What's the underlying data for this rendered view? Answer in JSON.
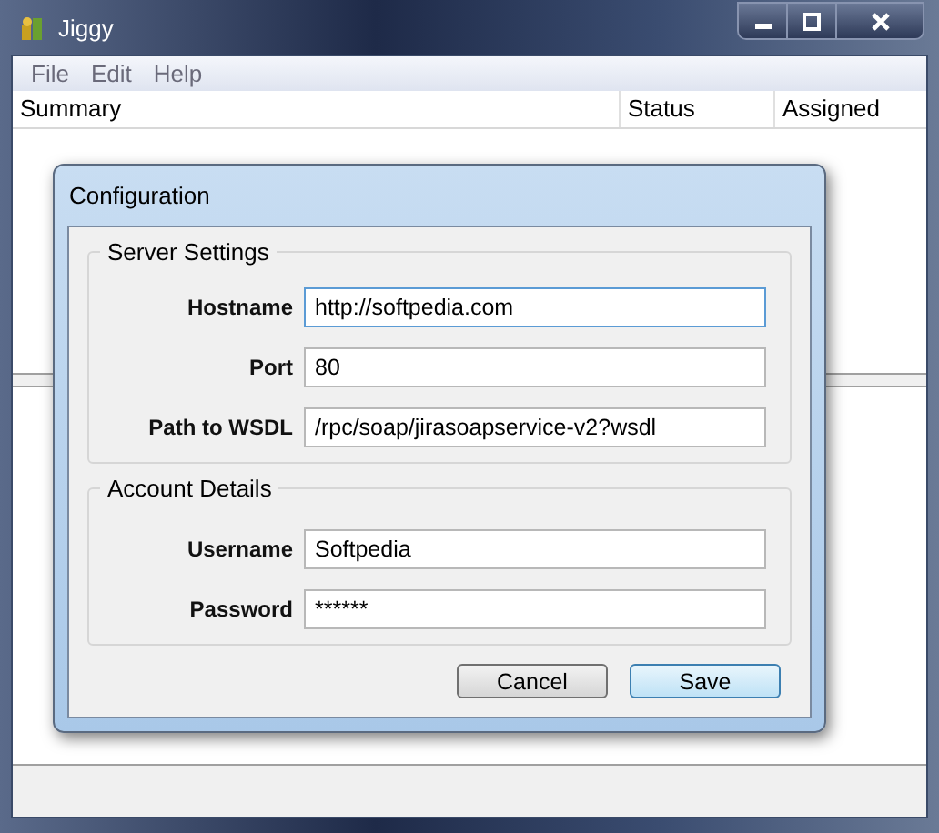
{
  "window": {
    "title": "Jiggy"
  },
  "menu": [
    "File",
    "Edit",
    "Help"
  ],
  "table": {
    "columns": [
      "Summary",
      "Status",
      "Assigned"
    ]
  },
  "dialog": {
    "title": "Configuration",
    "sections": [
      {
        "title": "Server Settings",
        "fields": [
          {
            "label": "Hostname",
            "value": "http://softpedia.com",
            "focused": true
          },
          {
            "label": "Port",
            "value": "80",
            "focused": false
          },
          {
            "label": "Path to WSDL",
            "value": "/rpc/soap/jirasoapservice-v2?wsdl",
            "focused": false
          }
        ]
      },
      {
        "title": "Account Details",
        "fields": [
          {
            "label": "Username",
            "value": "Softpedia",
            "focused": false
          },
          {
            "label": "Password",
            "value": "******",
            "focused": false
          }
        ]
      }
    ],
    "buttons": [
      {
        "label": "Cancel",
        "default": false
      },
      {
        "label": "Save",
        "default": true
      }
    ]
  }
}
